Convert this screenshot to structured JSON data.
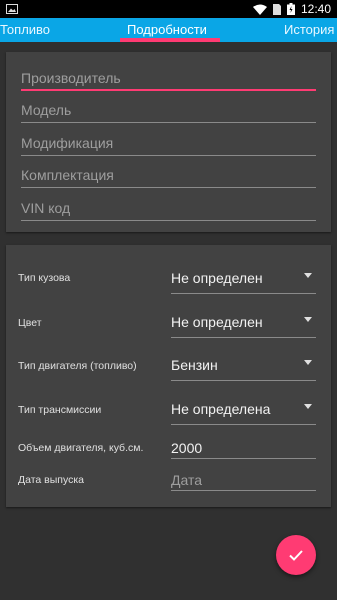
{
  "status_bar": {
    "time": "12:40"
  },
  "tabs": [
    {
      "label": "Топливо"
    },
    {
      "label": "Подробности"
    },
    {
      "label": "История"
    }
  ],
  "vehicle_info": {
    "manufacturer_placeholder": "Производитель",
    "model_placeholder": "Модель",
    "modification_placeholder": "Модификация",
    "trim_placeholder": "Комплектация",
    "vin_placeholder": "VIN код"
  },
  "specs": {
    "body_type": {
      "label": "Тип кузова",
      "value": "Не определен"
    },
    "color": {
      "label": "Цвет",
      "value": "Не определен"
    },
    "engine_type": {
      "label": "Тип двигателя (топливо)",
      "value": "Бензин"
    },
    "transmission": {
      "label": "Тип трансмиссии",
      "value": "Не определена"
    },
    "engine_volume": {
      "label": "Объем двигателя, куб.см.",
      "value": "2000"
    },
    "release_date": {
      "label": "Дата выпуска",
      "placeholder": "Дата"
    }
  },
  "colors": {
    "accent": "#ff3b73",
    "tab_bar": "#0aa6e6",
    "background": "#303030",
    "card": "#424242"
  },
  "fab": {
    "icon": "check-icon"
  }
}
